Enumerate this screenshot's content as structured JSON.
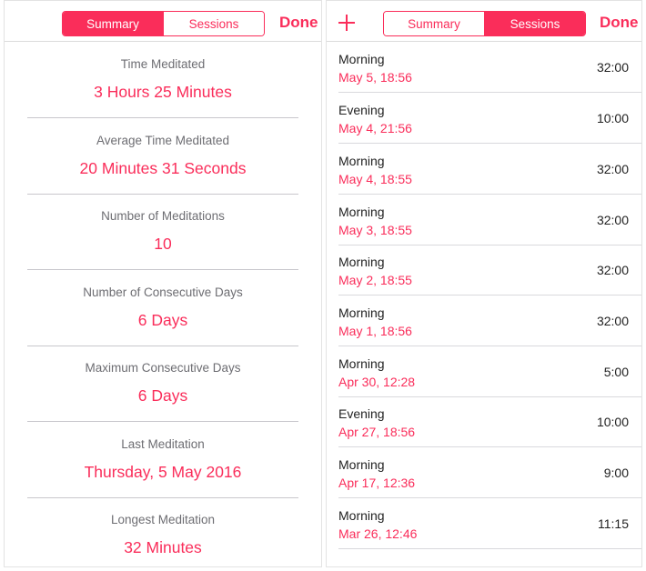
{
  "summary_screen": {
    "segments": [
      "Summary",
      "Sessions"
    ],
    "done_label": "Done",
    "stats": [
      {
        "label": "Time Meditated",
        "value": "3 Hours 25 Minutes"
      },
      {
        "label": "Average Time Meditated",
        "value": "20 Minutes 31 Seconds"
      },
      {
        "label": "Number of Meditations",
        "value": "10"
      },
      {
        "label": "Number of Consecutive Days",
        "value": "6 Days"
      },
      {
        "label": "Maximum Consecutive Days",
        "value": "6 Days"
      },
      {
        "label": "Last Meditation",
        "value": "Thursday, 5 May 2016"
      },
      {
        "label": "Longest Meditation",
        "value": "32 Minutes"
      }
    ]
  },
  "sessions_screen": {
    "add_icon": "plus-icon",
    "segments": [
      "Summary",
      "Sessions"
    ],
    "done_label": "Done",
    "sessions": [
      {
        "name": "Morning",
        "date": "May 5, 18:56",
        "duration": "32:00"
      },
      {
        "name": "Evening",
        "date": "May 4, 21:56",
        "duration": "10:00"
      },
      {
        "name": "Morning",
        "date": "May 4, 18:55",
        "duration": "32:00"
      },
      {
        "name": "Morning",
        "date": "May 3, 18:55",
        "duration": "32:00"
      },
      {
        "name": "Morning",
        "date": "May 2, 18:55",
        "duration": "32:00"
      },
      {
        "name": "Morning",
        "date": "May 1, 18:56",
        "duration": "32:00"
      },
      {
        "name": "Morning",
        "date": "Apr 30, 12:28",
        "duration": "5:00"
      },
      {
        "name": "Evening",
        "date": "Apr 27, 18:56",
        "duration": "10:00"
      },
      {
        "name": "Morning",
        "date": "Apr 17, 12:36",
        "duration": "9:00"
      },
      {
        "name": "Morning",
        "date": "Mar 26, 12:46",
        "duration": "11:15"
      }
    ]
  },
  "colors": {
    "accent": "#fa2d5a",
    "label_gray": "#6d6d72",
    "separator": "#c8c7cc"
  }
}
